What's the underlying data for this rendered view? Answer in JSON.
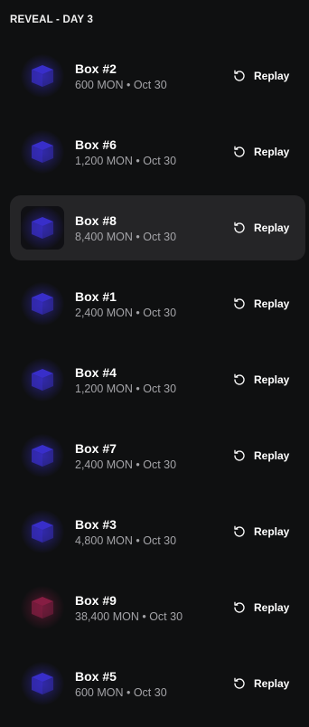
{
  "section_title": "REVEAL - DAY 3",
  "replay_label": "Replay",
  "items": [
    {
      "name": "Box #2",
      "amount": "600 MON",
      "date": "Oct 30",
      "color": "#3a2fd0",
      "selected": false
    },
    {
      "name": "Box #6",
      "amount": "1,200 MON",
      "date": "Oct 30",
      "color": "#3a2fd0",
      "selected": false
    },
    {
      "name": "Box #8",
      "amount": "8,400 MON",
      "date": "Oct 30",
      "color": "#3a2fd0",
      "selected": true
    },
    {
      "name": "Box #1",
      "amount": "2,400 MON",
      "date": "Oct 30",
      "color": "#3a2fd0",
      "selected": false
    },
    {
      "name": "Box #4",
      "amount": "1,200 MON",
      "date": "Oct 30",
      "color": "#3a2fd0",
      "selected": false
    },
    {
      "name": "Box #7",
      "amount": "2,400 MON",
      "date": "Oct 30",
      "color": "#3a2fd0",
      "selected": false
    },
    {
      "name": "Box #3",
      "amount": "4,800 MON",
      "date": "Oct 30",
      "color": "#3a2fd0",
      "selected": false
    },
    {
      "name": "Box #9",
      "amount": "38,400 MON",
      "date": "Oct 30",
      "color": "#8a1e45",
      "selected": false
    },
    {
      "name": "Box #5",
      "amount": "600 MON",
      "date": "Oct 30",
      "color": "#3a2fd0",
      "selected": false
    }
  ]
}
